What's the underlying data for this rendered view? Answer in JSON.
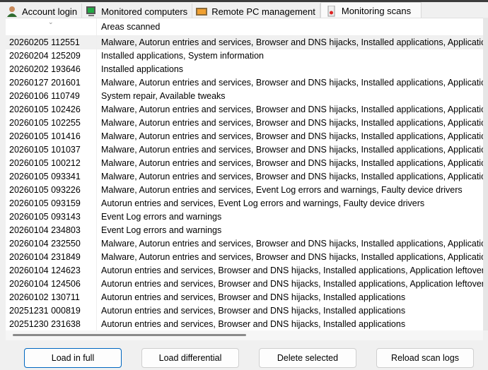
{
  "tabs": [
    {
      "label": "Account login",
      "icon": "user-icon"
    },
    {
      "label": "Monitored computers",
      "icon": "computer-icon"
    },
    {
      "label": "Remote PC management",
      "icon": "remote-icon"
    },
    {
      "label": "Monitoring scans",
      "icon": "scan-icon",
      "active": true
    }
  ],
  "table": {
    "columns": [
      "",
      "Areas scanned"
    ],
    "rows": [
      [
        "20260205 112551",
        "Malware, Autorun entries and services, Browser and DNS hijacks, Installed applications, Application leftovers"
      ],
      [
        "20260204 125209",
        "Installed applications, System information"
      ],
      [
        "20260202 193646",
        "Installed applications"
      ],
      [
        "20260127 201601",
        "Malware, Autorun entries and services, Browser and DNS hijacks, Installed applications, Application leftovers"
      ],
      [
        "20260106 110749",
        "System repair, Available tweaks"
      ],
      [
        "20260105 102426",
        "Malware, Autorun entries and services, Browser and DNS hijacks, Installed applications, Application leftovers"
      ],
      [
        "20260105 102255",
        "Malware, Autorun entries and services, Browser and DNS hijacks, Installed applications, Application leftovers"
      ],
      [
        "20260105 101416",
        "Malware, Autorun entries and services, Browser and DNS hijacks, Installed applications, Application leftovers"
      ],
      [
        "20260105 101037",
        "Malware, Autorun entries and services, Browser and DNS hijacks, Installed applications, Application leftovers"
      ],
      [
        "20260105 100212",
        "Malware, Autorun entries and services, Browser and DNS hijacks, Installed applications, Application leftovers"
      ],
      [
        "20260105 093341",
        "Malware, Autorun entries and services, Browser and DNS hijacks, Installed applications, Application leftovers"
      ],
      [
        "20260105 093226",
        "Malware, Autorun entries and services, Event Log errors and warnings, Faulty device drivers"
      ],
      [
        "20260105 093159",
        "Autorun entries and services, Event Log errors and warnings, Faulty device drivers"
      ],
      [
        "20260105 093143",
        "Event Log errors and warnings"
      ],
      [
        "20260104 234803",
        "Event Log errors and warnings"
      ],
      [
        "20260104 232550",
        "Malware, Autorun entries and services, Browser and DNS hijacks, Installed applications, Application leftovers"
      ],
      [
        "20260104 231849",
        "Malware, Autorun entries and services, Browser and DNS hijacks, Installed applications, Application leftovers"
      ],
      [
        "20260104 124623",
        "Autorun entries and services, Browser and DNS hijacks, Installed applications, Application leftovers, System"
      ],
      [
        "20260104 124506",
        "Autorun entries and services, Browser and DNS hijacks, Installed applications, Application leftovers, System"
      ],
      [
        "20260102 130711",
        "Autorun entries and services, Browser and DNS hijacks, Installed applications"
      ],
      [
        "20251231 000819",
        "Autorun entries and services, Browser and DNS hijacks, Installed applications"
      ],
      [
        "20251230 231638",
        "Autorun entries and services, Browser and DNS hijacks, Installed applications"
      ]
    ]
  },
  "buttons": {
    "load_full": "Load in full",
    "load_diff": "Load differential",
    "delete": "Delete selected",
    "reload": "Reload scan logs"
  }
}
